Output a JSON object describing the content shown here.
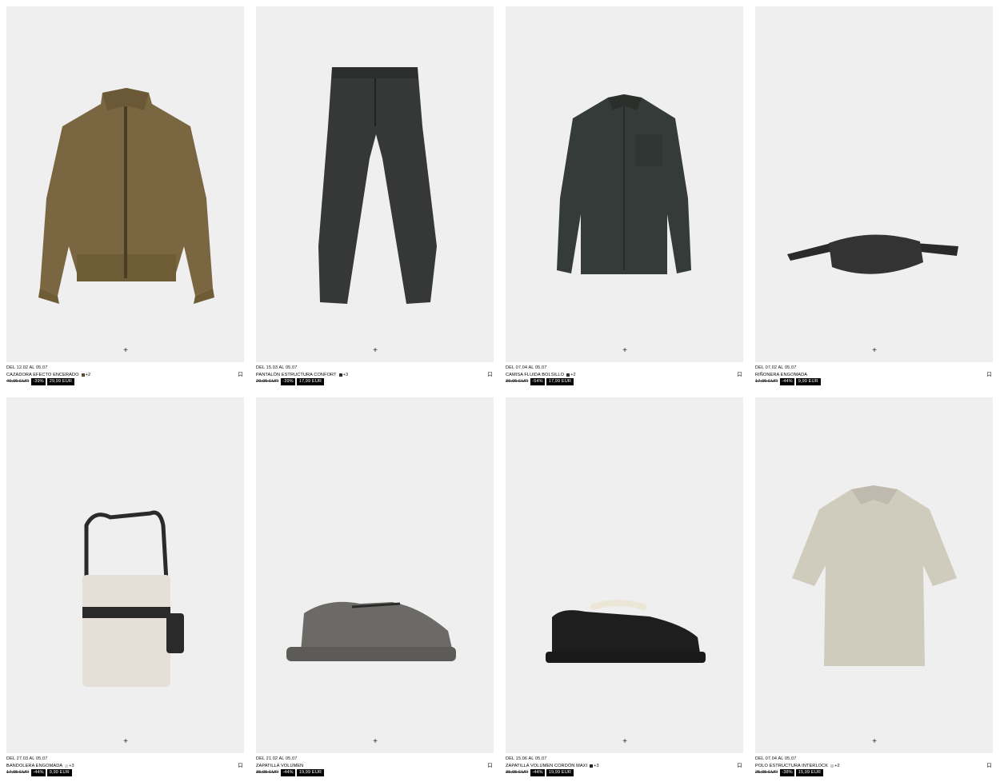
{
  "products": [
    {
      "dates": "DEL 12.02 AL 05.07",
      "name": "CAZADORA EFECTO ENCERADO",
      "swatch": "#5a4a2e",
      "colors": "+2",
      "old_price": "49,95 EUR",
      "discount": "-39%",
      "price": "29,99 EUR",
      "plus": "+",
      "icon": "jacket-image"
    },
    {
      "dates": "DEL 15.03 AL 05.07",
      "name": "PANTALÓN ESTRUCTURA CONFORT",
      "swatch": "#2b2b2b",
      "colors": "+3",
      "old_price": "29,95 EUR",
      "discount": "-39%",
      "price": "17,99 EUR",
      "plus": "+",
      "icon": "trousers-image"
    },
    {
      "dates": "DEL 07.04 AL 05.07",
      "name": "CAMISA FLUIDA BOLSILLO",
      "swatch": "#2f3430",
      "colors": "+2",
      "old_price": "39,95 EUR",
      "discount": "-54%",
      "price": "17,99 EUR",
      "plus": "+",
      "icon": "shirt-image"
    },
    {
      "dates": "DEL 07.02 AL 05.07",
      "name": "RIÑONERA ENGOMADA",
      "swatch": "",
      "colors": "",
      "old_price": "17,95 EUR",
      "discount": "-44%",
      "price": "9,99 EUR",
      "plus": "+",
      "icon": "belt-bag-image"
    },
    {
      "dates": "DEL 27.03 AL 05.07",
      "name": "BANDOLERA ENGOMADA",
      "swatch": "#d9d4cc",
      "colors": "+3",
      "old_price": "17,95 EUR",
      "discount": "-44%",
      "price": "9,99 EUR",
      "plus": "+",
      "icon": "crossbody-bag-image"
    },
    {
      "dates": "DEL 21.02 AL 05.07",
      "name": "ZAPATILLA VOLUMEN",
      "swatch": "",
      "colors": "",
      "old_price": "35,95 EUR",
      "discount": "-44%",
      "price": "19,99 EUR",
      "plus": "+",
      "icon": "chunky-sneaker-image"
    },
    {
      "dates": "DEL 15.06 AL 05.07",
      "name": "ZAPATILLA VOLUMEN CORDÓN MAXI",
      "swatch": "#222222",
      "colors": "+3",
      "old_price": "35,95 EUR",
      "discount": "-44%",
      "price": "19,99 EUR",
      "plus": "+",
      "icon": "skate-sneaker-image"
    },
    {
      "dates": "DEL 07.04 AL 05.07",
      "name": "POLO ESTRUCTURA INTERLOCK",
      "swatch": "#cfcbbd",
      "colors": "+2",
      "old_price": "25,95 EUR",
      "discount": "-38%",
      "price": "15,99 EUR",
      "plus": "+",
      "icon": "polo-image"
    }
  ]
}
